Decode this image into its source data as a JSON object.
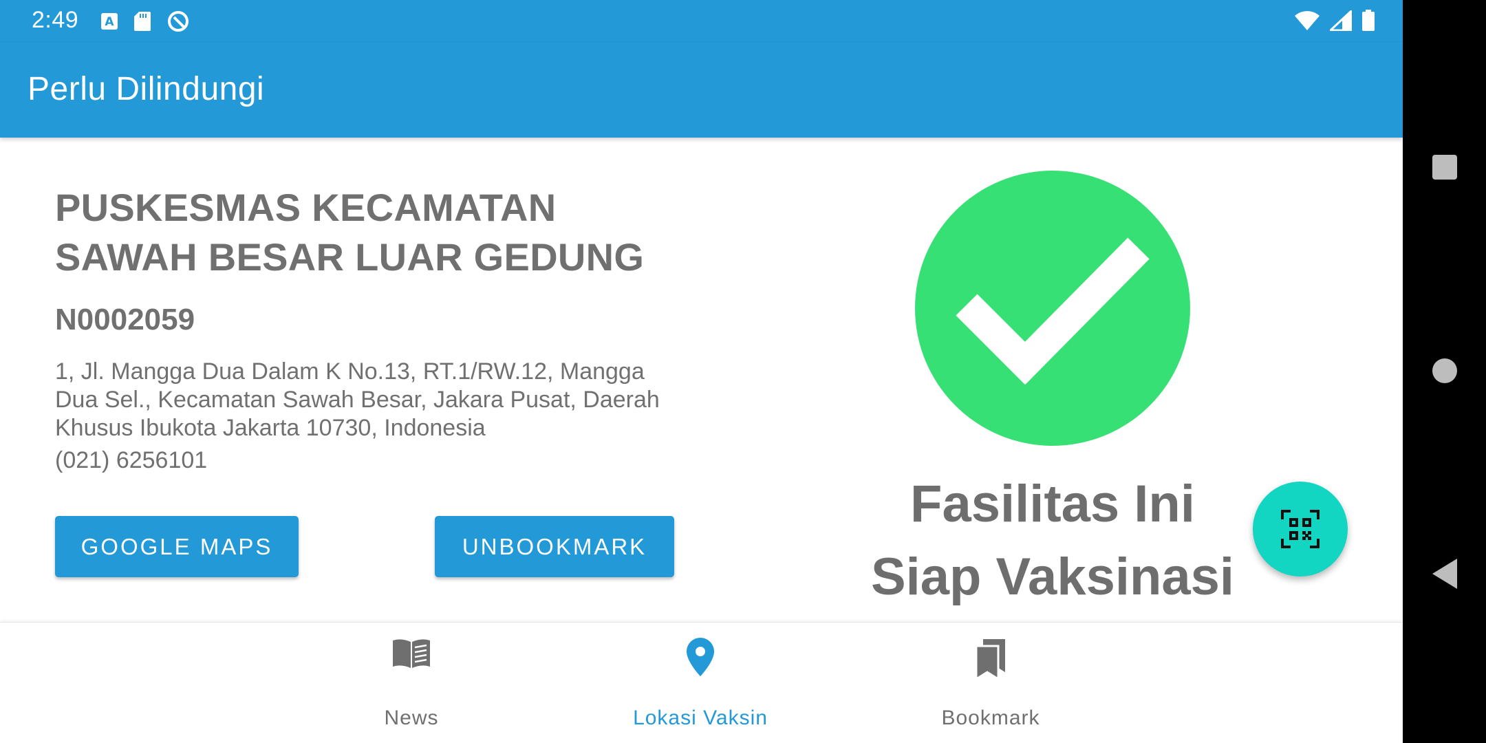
{
  "status_bar": {
    "time": "2:49",
    "left_icons": [
      "translate-a-icon",
      "sd-card-icon",
      "data-saver-icon"
    ],
    "right_icons": [
      "wifi-icon",
      "signal-icon",
      "battery-icon"
    ]
  },
  "app_bar": {
    "title": "Perlu Dilindungi"
  },
  "facility": {
    "name": "PUSKESMAS KECAMATAN SAWAH BESAR LUAR GEDUNG",
    "code": "N0002059",
    "address": "1, Jl. Mangga Dua Dalam K No.13, RT.1/RW.12, Mangga Dua Sel., Kecamatan Sawah Besar, Jakara Pusat, Daerah Khusus Ibukota Jakarta 10730, Indonesia",
    "phone": "(021) 6256101"
  },
  "actions": {
    "google_maps_label": "GOOGLE MAPS",
    "unbookmark_label": "UNBOOKMARK"
  },
  "vaccination_status": {
    "icon": "check-circle-icon",
    "message_line1": "Fasilitas Ini",
    "message_line2": "Siap Vaksinasi"
  },
  "fab": {
    "icon": "qr-scan-icon"
  },
  "bottom_nav": {
    "items": [
      {
        "label": "News",
        "icon": "book-open-icon",
        "active": false
      },
      {
        "label": "Lokasi Vaksin",
        "icon": "location-pin-icon",
        "active": true
      },
      {
        "label": "Bookmark",
        "icon": "bookmarks-icon",
        "active": false
      }
    ]
  },
  "system_nav": {
    "buttons": [
      "recents-button",
      "home-button",
      "back-button"
    ]
  },
  "colors": {
    "primary": "#2399d8",
    "success": "#37e074",
    "fab": "#12d6c2",
    "text_gray": "#707070"
  }
}
